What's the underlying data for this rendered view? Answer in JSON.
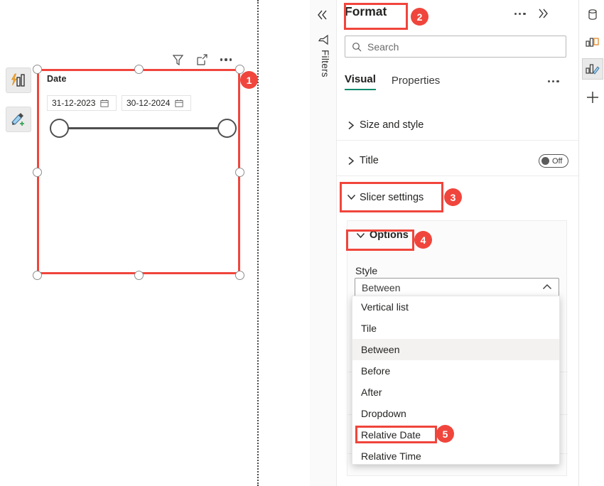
{
  "canvas": {
    "visual_header": {
      "filter_icon": "filter-icon",
      "focus_icon": "focus-mode-icon",
      "more_icon": "more-options-icon"
    },
    "tool_buttons": [
      {
        "name": "smart-narrative-button",
        "icon": "lightning-bar-chart-icon"
      },
      {
        "name": "format-painter-button",
        "icon": "paintbrush-plus-icon"
      }
    ],
    "slicer": {
      "title": "Date",
      "start_date": "31-12-2023",
      "end_date": "30-12-2024",
      "calendar_icon": "calendar-icon"
    }
  },
  "filters_rail": {
    "collapse_label": "«",
    "filter_icon": "filter-icon",
    "label": "Filters"
  },
  "pane": {
    "title": "Format",
    "more_icon": "more-options-icon",
    "expand_icon": "expand-chevrons-icon",
    "search": {
      "placeholder": "Search",
      "icon": "search-icon"
    },
    "tabs": [
      {
        "label": "Visual",
        "active": true
      },
      {
        "label": "Properties",
        "active": false
      }
    ],
    "tabs_more_icon": "more-options-icon",
    "sections": [
      {
        "label": "Size and style",
        "expanded": false
      },
      {
        "label": "Title",
        "expanded": false,
        "toggle": "Off"
      },
      {
        "label": "Slicer settings",
        "expanded": true
      }
    ],
    "slicer_settings": {
      "options_label": "Options",
      "style_label": "Style",
      "style_value": "Between",
      "style_chevron": "chevron-up-icon",
      "reset_icon": "reset-to-default-icon"
    },
    "style_dropdown": {
      "options": [
        {
          "label": "Vertical list",
          "selected": false
        },
        {
          "label": "Tile",
          "selected": false
        },
        {
          "label": "Between",
          "selected": true
        },
        {
          "label": "Before",
          "selected": false
        },
        {
          "label": "After",
          "selected": false
        },
        {
          "label": "Dropdown",
          "selected": false
        },
        {
          "label": "Relative Date",
          "selected": false
        },
        {
          "label": "Relative Time",
          "selected": false
        }
      ]
    }
  },
  "right_rail": [
    {
      "name": "data-pane-icon",
      "label": "Data",
      "active": false
    },
    {
      "name": "build-visual-icon",
      "label": "Build visual",
      "active": false
    },
    {
      "name": "format-visual-icon",
      "label": "Format visual",
      "active": true
    },
    {
      "name": "add-pane-icon",
      "label": "Add",
      "active": false
    }
  ],
  "annotations": {
    "badges": [
      "1",
      "2",
      "3",
      "4",
      "5"
    ],
    "accent_color": "#F0453C"
  }
}
